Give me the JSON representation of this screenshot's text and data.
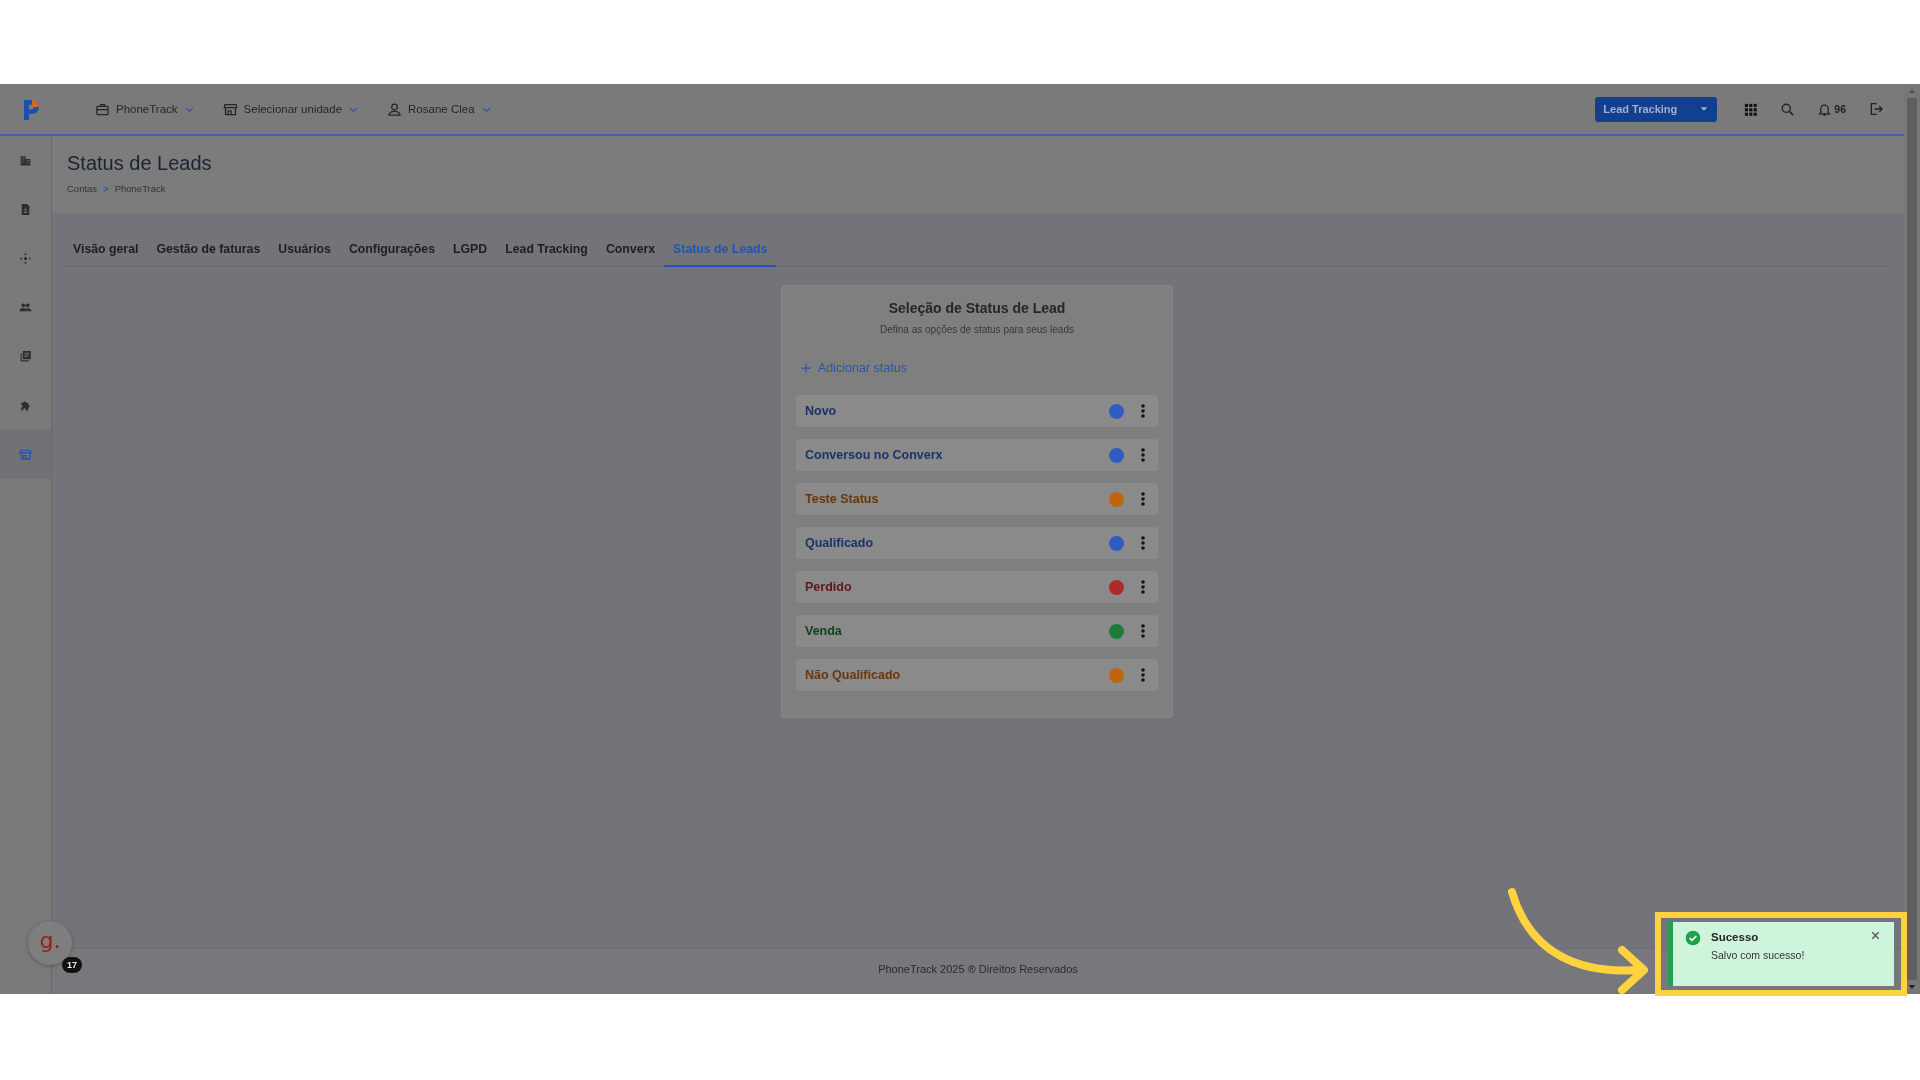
{
  "header": {
    "menus": [
      {
        "label": "PhoneTrack",
        "kind": "briefcase"
      },
      {
        "label": "Selecionar unidade",
        "kind": "store"
      },
      {
        "label": "Rosane Clea",
        "kind": "user"
      }
    ],
    "product_button": {
      "label": "Lead Tracking"
    },
    "notifications": {
      "count": "96"
    }
  },
  "sidebar": {
    "items": [
      {
        "kind": "buildings",
        "selected": false
      },
      {
        "kind": "document",
        "selected": false
      },
      {
        "kind": "move",
        "selected": false
      },
      {
        "kind": "people",
        "selected": false
      },
      {
        "kind": "library",
        "selected": false
      },
      {
        "kind": "puzzle",
        "selected": false
      },
      {
        "kind": "store",
        "selected": true
      }
    ]
  },
  "page": {
    "title": "Status de Leads",
    "breadcrumb": {
      "items": [
        "Contas",
        "PhoneTrack"
      ],
      "separator": ">"
    }
  },
  "tabs": [
    {
      "label": "Visão geral",
      "selected": false
    },
    {
      "label": "Gestão de faturas",
      "selected": false
    },
    {
      "label": "Usuários",
      "selected": false
    },
    {
      "label": "Configurações",
      "selected": false
    },
    {
      "label": "LGPD",
      "selected": false
    },
    {
      "label": "Lead Tracking",
      "selected": false
    },
    {
      "label": "Converx",
      "selected": false
    },
    {
      "label": "Status de Leads",
      "selected": true
    }
  ],
  "card": {
    "title": "Seleção de Status de Lead",
    "subtitle": "Defina as opções de status para seus leads",
    "add_button": "Adicionar status",
    "statuses": [
      {
        "name": "Novo",
        "color": "#2f5cc0"
      },
      {
        "name": "Conversou no Converx",
        "color": "#2f5cc0"
      },
      {
        "name": "Teste Status",
        "color": "#c0640f"
      },
      {
        "name": "Qualificado",
        "color": "#2f5cc0"
      },
      {
        "name": "Perdido",
        "color": "#b02a2a"
      },
      {
        "name": "Venda",
        "color": "#1e7a3a"
      },
      {
        "name": "Não Qualificado",
        "color": "#c0640f"
      }
    ]
  },
  "footer": {
    "text": "PhoneTrack 2025 ® Direitos Reservados"
  },
  "chat_widget": {
    "label": "g.",
    "badge": "17"
  },
  "toast": {
    "title": "Sucesso",
    "message": "Salvo com sucesso!"
  }
}
